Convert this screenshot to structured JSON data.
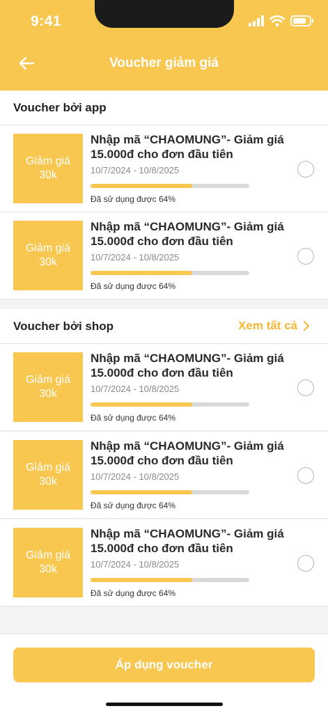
{
  "status": {
    "time": "9:41"
  },
  "header": {
    "title": "Voucher giảm giá"
  },
  "sections": {
    "app": {
      "title": "Voucher bởi app"
    },
    "shop": {
      "title": "Voucher bởi shop",
      "see_all": "Xem tất cả"
    }
  },
  "vouchers": [
    {
      "badge_line1": "Giảm giá",
      "badge_line2": "30k",
      "title": "Nhập mã “CHAOMUNG”- Giảm giá 15.000đ cho đơn đầu tiên",
      "date": "10/7/2024 - 10/8/2025",
      "usage": "Đã sử dụng được 64%",
      "used_percent": 64
    },
    {
      "badge_line1": "Giảm giá",
      "badge_line2": "30k",
      "title": "Nhập mã “CHAOMUNG”- Giảm giá 15.000đ cho đơn đầu tiên",
      "date": "10/7/2024 - 10/8/2025",
      "usage": "Đã sử dụng được 64%",
      "used_percent": 64
    },
    {
      "badge_line1": "Giảm giá",
      "badge_line2": "30k",
      "title": "Nhập mã “CHAOMUNG”- Giảm giá 15.000đ cho đơn đầu tiên",
      "date": "10/7/2024 - 10/8/2025",
      "usage": "Đã sử dụng được 64%",
      "used_percent": 64
    },
    {
      "badge_line1": "Giảm giá",
      "badge_line2": "30k",
      "title": "Nhập mã “CHAOMUNG”- Giảm giá 15.000đ cho đơn đầu tiên",
      "date": "10/7/2024 - 10/8/2025",
      "usage": "Đã sử dụng được 64%",
      "used_percent": 64
    },
    {
      "badge_line1": "Giảm giá",
      "badge_line2": "30k",
      "title": "Nhập mã “CHAOMUNG”- Giảm giá 15.000đ cho đơn đầu tiên",
      "date": "10/7/2024 - 10/8/2025",
      "usage": "Đã sử dụng được 64%",
      "used_percent": 64
    }
  ],
  "footer": {
    "apply_label": "Áp dụng voucher"
  },
  "colors": {
    "accent": "#f8c74f",
    "link": "#f5b731"
  },
  "icons": {
    "back": "arrow-left-icon",
    "see_all": "chevron-right-icon",
    "select": "radio-circle-icon"
  }
}
